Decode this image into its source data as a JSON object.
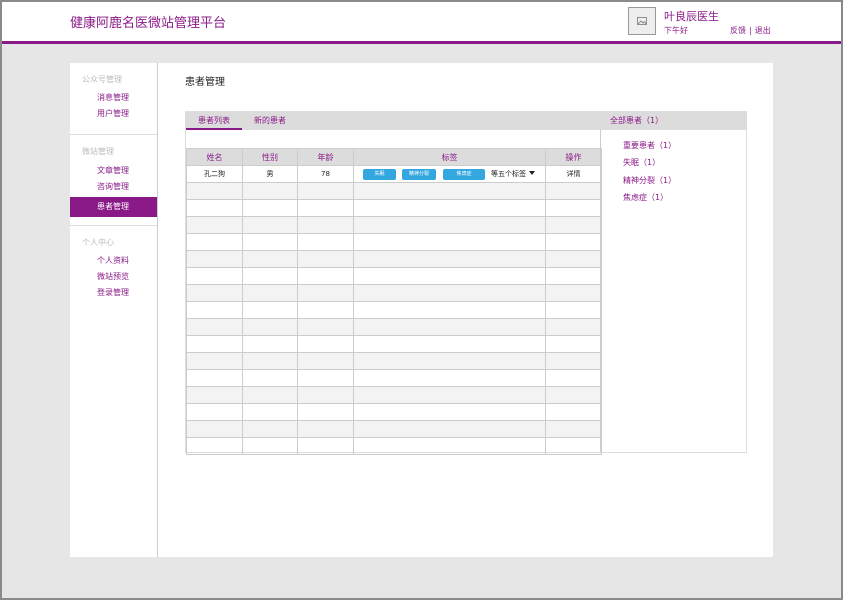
{
  "header": {
    "app_title": "健康阿鹿名医微站管理平台",
    "avatar_icon": "image-icon",
    "doctor_name": "叶良辰医生",
    "greeting": "下午好",
    "feedback_label": "反馈",
    "separator": "|",
    "logout_label": "退出",
    "accent_color": "#8b1a89"
  },
  "sidebar": {
    "groups": [
      {
        "title": "公众号管理",
        "items": [
          "消息管理",
          "用户管理"
        ]
      },
      {
        "title": "微站管理",
        "items": [
          "文章管理",
          "咨询管理",
          "患者管理"
        ]
      },
      {
        "title": "个人中心",
        "items": [
          "个人资料",
          "微站预览",
          "登录管理"
        ]
      }
    ],
    "active_item": "患者管理"
  },
  "main": {
    "page_title": "患者管理",
    "tabs": [
      "患者列表",
      "新的患者"
    ],
    "active_tab": "患者列表",
    "table": {
      "columns": [
        "姓名",
        "性别",
        "年龄",
        "标签",
        "操作"
      ],
      "rows": [
        {
          "name": "孔二狗",
          "gender": "男",
          "age": "78",
          "tags": [
            "失眠",
            "精神分裂",
            "焦虑症"
          ],
          "more_tags": "等五个标签",
          "action": "详情"
        }
      ],
      "empty_rows": 16,
      "tag_color": "#35a7e0"
    },
    "categories": {
      "header": "全部患者（1）",
      "items": [
        "重要患者（1）",
        "失眠（1）",
        "精神分裂（1）",
        "焦虑症（1）"
      ]
    }
  }
}
